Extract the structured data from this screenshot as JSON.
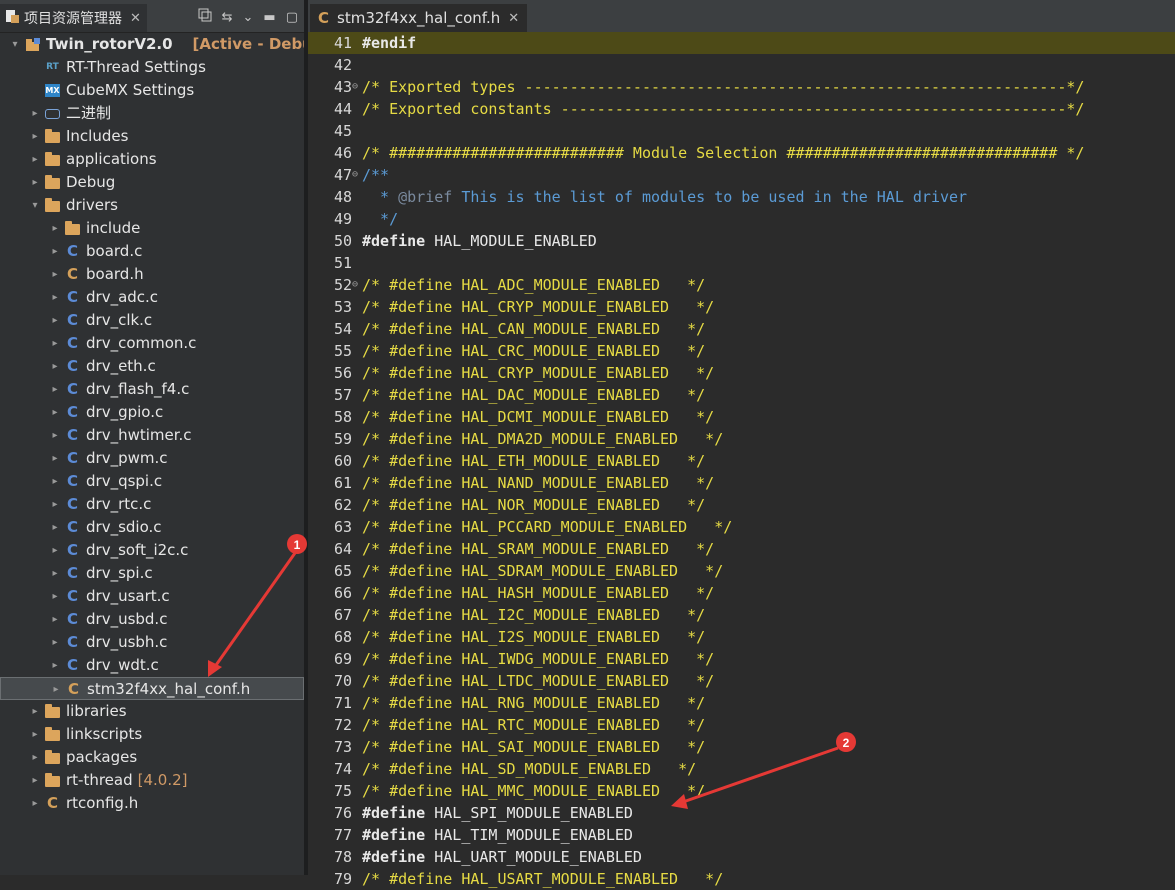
{
  "left_panel": {
    "tab_title": "项目资源管理器",
    "tree": [
      {
        "label": "Twin_rotorV2.0",
        "extra": "[Active - Debug]",
        "icon": "project-icon",
        "level": 0,
        "twisty": "open",
        "kind": "project"
      },
      {
        "label": "RT-Thread Settings",
        "icon": "rt-thread-icon",
        "level": 1,
        "twisty": "none"
      },
      {
        "label": "CubeMX Settings",
        "icon": "cubemx-icon",
        "level": 1,
        "twisty": "none"
      },
      {
        "label": "二进制",
        "icon": "binaries-icon",
        "level": 1,
        "twisty": "closed"
      },
      {
        "label": "Includes",
        "icon": "includes-icon",
        "level": 1,
        "twisty": "closed"
      },
      {
        "label": "applications",
        "icon": "folder-icon",
        "level": 1,
        "twisty": "closed"
      },
      {
        "label": "Debug",
        "icon": "folder-icon",
        "level": 1,
        "twisty": "closed"
      },
      {
        "label": "drivers",
        "icon": "folder-icon",
        "level": 1,
        "twisty": "open"
      },
      {
        "label": "include",
        "icon": "folder-icon",
        "level": 2,
        "twisty": "closed"
      },
      {
        "label": "board.c",
        "icon": "c-file-icon",
        "level": 2,
        "twisty": "closed"
      },
      {
        "label": "board.h",
        "icon": "h-file-icon",
        "level": 2,
        "twisty": "closed"
      },
      {
        "label": "drv_adc.c",
        "icon": "c-file-icon",
        "level": 2,
        "twisty": "closed"
      },
      {
        "label": "drv_clk.c",
        "icon": "c-file-icon",
        "level": 2,
        "twisty": "closed"
      },
      {
        "label": "drv_common.c",
        "icon": "c-file-icon",
        "level": 2,
        "twisty": "closed"
      },
      {
        "label": "drv_eth.c",
        "icon": "c-file-icon",
        "level": 2,
        "twisty": "closed"
      },
      {
        "label": "drv_flash_f4.c",
        "icon": "c-file-icon",
        "level": 2,
        "twisty": "closed"
      },
      {
        "label": "drv_gpio.c",
        "icon": "c-file-icon",
        "level": 2,
        "twisty": "closed"
      },
      {
        "label": "drv_hwtimer.c",
        "icon": "c-file-icon",
        "level": 2,
        "twisty": "closed"
      },
      {
        "label": "drv_pwm.c",
        "icon": "c-file-icon",
        "level": 2,
        "twisty": "closed"
      },
      {
        "label": "drv_qspi.c",
        "icon": "c-file-icon",
        "level": 2,
        "twisty": "closed"
      },
      {
        "label": "drv_rtc.c",
        "icon": "c-file-icon",
        "level": 2,
        "twisty": "closed"
      },
      {
        "label": "drv_sdio.c",
        "icon": "c-file-icon",
        "level": 2,
        "twisty": "closed"
      },
      {
        "label": "drv_soft_i2c.c",
        "icon": "c-file-icon",
        "level": 2,
        "twisty": "closed"
      },
      {
        "label": "drv_spi.c",
        "icon": "c-file-icon",
        "level": 2,
        "twisty": "closed"
      },
      {
        "label": "drv_usart.c",
        "icon": "c-file-icon",
        "level": 2,
        "twisty": "closed"
      },
      {
        "label": "drv_usbd.c",
        "icon": "c-file-icon",
        "level": 2,
        "twisty": "closed"
      },
      {
        "label": "drv_usbh.c",
        "icon": "c-file-icon",
        "level": 2,
        "twisty": "closed"
      },
      {
        "label": "drv_wdt.c",
        "icon": "c-file-icon",
        "level": 2,
        "twisty": "closed"
      },
      {
        "label": "stm32f4xx_hal_conf.h",
        "icon": "h-file-icon",
        "level": 2,
        "twisty": "closed",
        "selected": true
      },
      {
        "label": "libraries",
        "icon": "folder-icon",
        "level": 1,
        "twisty": "closed"
      },
      {
        "label": "linkscripts",
        "icon": "folder-icon",
        "level": 1,
        "twisty": "closed"
      },
      {
        "label": "packages",
        "icon": "folder-icon",
        "level": 1,
        "twisty": "closed"
      },
      {
        "label": "rt-thread",
        "extra": "[4.0.2]",
        "icon": "folder-icon",
        "level": 1,
        "twisty": "closed"
      },
      {
        "label": "rtconfig.h",
        "icon": "h-file-icon",
        "level": 1,
        "twisty": "closed"
      }
    ]
  },
  "editor": {
    "tab_title": "stm32f4xx_hal_conf.h",
    "lines": [
      {
        "n": "41",
        "segs": [
          [
            "pp",
            "#endif"
          ]
        ],
        "hl": true
      },
      {
        "n": "42",
        "segs": []
      },
      {
        "n": "43",
        "fold": true,
        "segs": [
          [
            "cmt",
            "/* Exported types ------------------------------------------------------------*/"
          ]
        ]
      },
      {
        "n": "44",
        "segs": [
          [
            "cmt",
            "/* Exported constants --------------------------------------------------------*/"
          ]
        ]
      },
      {
        "n": "45",
        "segs": []
      },
      {
        "n": "46",
        "segs": [
          [
            "cmt",
            "/* ########################## Module Selection ############################## */"
          ]
        ]
      },
      {
        "n": "47",
        "fold": true,
        "segs": [
          [
            "doc",
            "/**"
          ]
        ]
      },
      {
        "n": "48",
        "segs": [
          [
            "doc",
            "  * "
          ],
          [
            "dtag",
            "@brief"
          ],
          [
            "doc",
            " This is the list of modules to be used in the HAL driver"
          ]
        ]
      },
      {
        "n": "49",
        "segs": [
          [
            "doc",
            "  */"
          ]
        ]
      },
      {
        "n": "50",
        "segs": [
          [
            "kw",
            "#define"
          ],
          [
            "plain",
            " HAL_MODULE_ENABLED"
          ]
        ]
      },
      {
        "n": "51",
        "segs": []
      },
      {
        "n": "52",
        "fold": true,
        "segs": [
          [
            "cmt",
            "/* #define HAL_ADC_MODULE_ENABLED   */"
          ]
        ]
      },
      {
        "n": "53",
        "segs": [
          [
            "cmt",
            "/* #define HAL_CRYP_MODULE_ENABLED   */"
          ]
        ]
      },
      {
        "n": "54",
        "segs": [
          [
            "cmt",
            "/* #define HAL_CAN_MODULE_ENABLED   */"
          ]
        ]
      },
      {
        "n": "55",
        "segs": [
          [
            "cmt",
            "/* #define HAL_CRC_MODULE_ENABLED   */"
          ]
        ]
      },
      {
        "n": "56",
        "segs": [
          [
            "cmt",
            "/* #define HAL_CRYP_MODULE_ENABLED   */"
          ]
        ]
      },
      {
        "n": "57",
        "segs": [
          [
            "cmt",
            "/* #define HAL_DAC_MODULE_ENABLED   */"
          ]
        ]
      },
      {
        "n": "58",
        "segs": [
          [
            "cmt",
            "/* #define HAL_DCMI_MODULE_ENABLED   */"
          ]
        ]
      },
      {
        "n": "59",
        "segs": [
          [
            "cmt",
            "/* #define HAL_DMA2D_MODULE_ENABLED   */"
          ]
        ]
      },
      {
        "n": "60",
        "segs": [
          [
            "cmt",
            "/* #define HAL_ETH_MODULE_ENABLED   */"
          ]
        ]
      },
      {
        "n": "61",
        "segs": [
          [
            "cmt",
            "/* #define HAL_NAND_MODULE_ENABLED   */"
          ]
        ]
      },
      {
        "n": "62",
        "segs": [
          [
            "cmt",
            "/* #define HAL_NOR_MODULE_ENABLED   */"
          ]
        ]
      },
      {
        "n": "63",
        "segs": [
          [
            "cmt",
            "/* #define HAL_PCCARD_MODULE_ENABLED   */"
          ]
        ]
      },
      {
        "n": "64",
        "segs": [
          [
            "cmt",
            "/* #define HAL_SRAM_MODULE_ENABLED   */"
          ]
        ]
      },
      {
        "n": "65",
        "segs": [
          [
            "cmt",
            "/* #define HAL_SDRAM_MODULE_ENABLED   */"
          ]
        ]
      },
      {
        "n": "66",
        "segs": [
          [
            "cmt",
            "/* #define HAL_HASH_MODULE_ENABLED   */"
          ]
        ]
      },
      {
        "n": "67",
        "segs": [
          [
            "cmt",
            "/* #define HAL_I2C_MODULE_ENABLED   */"
          ]
        ]
      },
      {
        "n": "68",
        "segs": [
          [
            "cmt",
            "/* #define HAL_I2S_MODULE_ENABLED   */"
          ]
        ]
      },
      {
        "n": "69",
        "segs": [
          [
            "cmt",
            "/* #define HAL_IWDG_MODULE_ENABLED   */"
          ]
        ]
      },
      {
        "n": "70",
        "segs": [
          [
            "cmt",
            "/* #define HAL_LTDC_MODULE_ENABLED   */"
          ]
        ]
      },
      {
        "n": "71",
        "segs": [
          [
            "cmt",
            "/* #define HAL_RNG_MODULE_ENABLED   */"
          ]
        ]
      },
      {
        "n": "72",
        "segs": [
          [
            "cmt",
            "/* #define HAL_RTC_MODULE_ENABLED   */"
          ]
        ]
      },
      {
        "n": "73",
        "segs": [
          [
            "cmt",
            "/* #define HAL_SAI_MODULE_ENABLED   */"
          ]
        ]
      },
      {
        "n": "74",
        "segs": [
          [
            "cmt",
            "/* #define HAL_SD_MODULE_ENABLED   */"
          ]
        ]
      },
      {
        "n": "75",
        "segs": [
          [
            "cmt",
            "/* #define HAL_MMC_MODULE_ENABLED   */"
          ]
        ]
      },
      {
        "n": "76",
        "segs": [
          [
            "kw",
            "#define"
          ],
          [
            "plain",
            " HAL_SPI_MODULE_ENABLED"
          ]
        ]
      },
      {
        "n": "77",
        "segs": [
          [
            "kw",
            "#define"
          ],
          [
            "plain",
            " HAL_TIM_MODULE_ENABLED"
          ]
        ]
      },
      {
        "n": "78",
        "segs": [
          [
            "kw",
            "#define"
          ],
          [
            "plain",
            " HAL_UART_MODULE_ENABLED"
          ]
        ]
      },
      {
        "n": "79",
        "segs": [
          [
            "cmt",
            "/* #define HAL_USART_MODULE_ENABLED   */"
          ]
        ]
      }
    ]
  },
  "annotations": [
    {
      "label": "1",
      "color": "#e53935"
    },
    {
      "label": "2",
      "color": "#e53935"
    }
  ],
  "colors": {
    "comment": "#e6db44",
    "doc": "#5b9bd5",
    "highlight": "#4d4a17",
    "active_tag": "#d19a66"
  }
}
